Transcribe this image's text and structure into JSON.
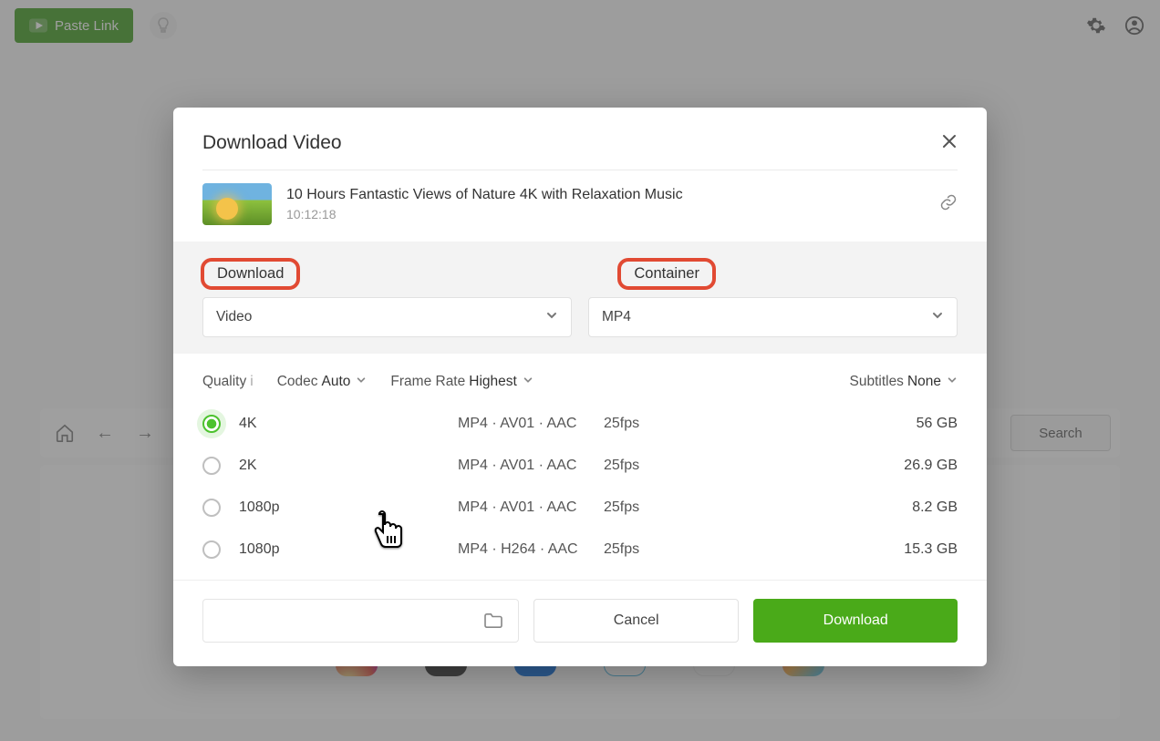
{
  "topbar": {
    "paste_label": "Paste Link"
  },
  "bg": {
    "search_label": "Search"
  },
  "modal": {
    "title": "Download Video",
    "video_title": "10 Hours Fantastic Views of Nature 4K with Relaxation Music",
    "duration": "10:12:18",
    "download_label": "Download",
    "container_label": "Container",
    "download_type": "Video",
    "container_type": "MP4",
    "filters": {
      "quality_label": "Quality",
      "quality_badge": "i",
      "codec_label": "Codec",
      "codec_value": "Auto",
      "framerate_label": "Frame Rate",
      "framerate_value": "Highest",
      "subtitles_label": "Subtitles",
      "subtitles_value": "None"
    },
    "qualities": [
      {
        "res": "4K",
        "fmt": "MP4 · AV01 · AAC",
        "fps": "25fps",
        "size": "56 GB",
        "selected": true
      },
      {
        "res": "2K",
        "fmt": "MP4 · AV01 · AAC",
        "fps": "25fps",
        "size": "26.9 GB",
        "selected": false
      },
      {
        "res": "1080p",
        "fmt": "MP4 · AV01 · AAC",
        "fps": "25fps",
        "size": "8.2 GB",
        "selected": false
      },
      {
        "res": "1080p",
        "fmt": "MP4 · H264 · AAC",
        "fps": "25fps",
        "size": "15.3 GB",
        "selected": false
      }
    ],
    "cancel": "Cancel",
    "download_btn": "Download"
  }
}
